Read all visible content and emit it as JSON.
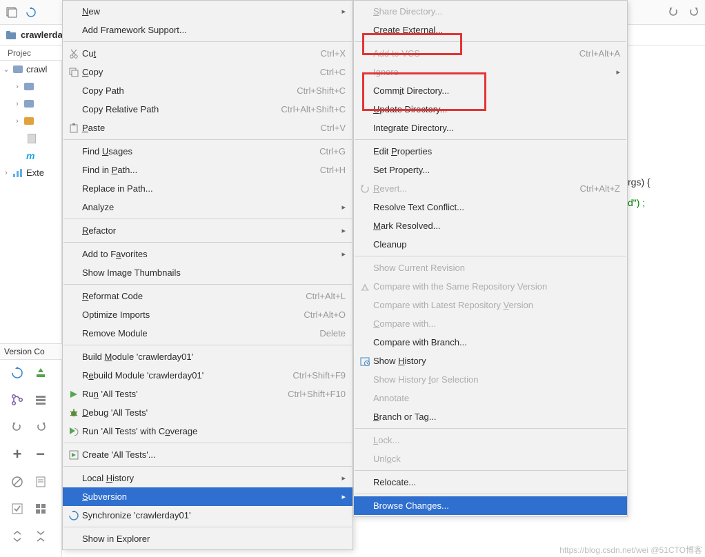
{
  "breadcrumb": {
    "project": "crawlerda"
  },
  "toolbar_tabs": {
    "project": "Projec"
  },
  "tree": {
    "root": "crawl",
    "meta": "m",
    "ext": "Exte"
  },
  "version_panel": {
    "title": "Version Co"
  },
  "editor": {
    "args_frag": "rgs) {",
    "d_frag": "d\") ;"
  },
  "watermark": "https://blog.csdn.net/wei @51CTO博客",
  "menu_main": {
    "new": "New",
    "add_framework": "Add Framework Support...",
    "cut": "Cut",
    "cut_sc": "Ctrl+X",
    "copy": "Copy",
    "copy_sc": "Ctrl+C",
    "copy_path": "Copy Path",
    "copy_path_sc": "Ctrl+Shift+C",
    "copy_rel": "Copy Relative Path",
    "copy_rel_sc": "Ctrl+Alt+Shift+C",
    "paste": "Paste",
    "paste_sc": "Ctrl+V",
    "find_usages": "Find Usages",
    "find_usages_sc": "Ctrl+G",
    "find_in_path": "Find in Path...",
    "find_in_path_sc": "Ctrl+H",
    "replace_in_path": "Replace in Path...",
    "analyze": "Analyze",
    "refactor": "Refactor",
    "add_fav": "Add to Favorites",
    "show_thumbs": "Show Image Thumbnails",
    "reformat": "Reformat Code",
    "reformat_sc": "Ctrl+Alt+L",
    "optimize": "Optimize Imports",
    "optimize_sc": "Ctrl+Alt+O",
    "remove_mod": "Remove Module",
    "remove_mod_sc": "Delete",
    "build_mod": "Build Module 'crawlerday01'",
    "rebuild_mod": "Rebuild Module 'crawlerday01'",
    "rebuild_mod_sc": "Ctrl+Shift+F9",
    "run": "Run 'All Tests'",
    "run_sc": "Ctrl+Shift+F10",
    "debug": "Debug 'All Tests'",
    "run_cov": "Run 'All Tests' with Coverage",
    "create_tests": "Create 'All Tests'...",
    "local_hist": "Local History",
    "subversion": "Subversion",
    "sync": "Synchronize 'crawlerday01'",
    "show_explorer": "Show in Explorer"
  },
  "menu_sub": {
    "share": "Share Directory...",
    "create_ext": "Create External...",
    "add_vcs": "Add to VCS",
    "add_vcs_sc": "Ctrl+Alt+A",
    "ignore": "Ignore",
    "commit": "Commit Directory...",
    "update": "Update Directory...",
    "integrate": "Integrate Directory...",
    "edit_props": "Edit Properties",
    "set_prop": "Set Property...",
    "revert": "Revert...",
    "revert_sc": "Ctrl+Alt+Z",
    "resolve_text": "Resolve Text Conflict...",
    "mark_res": "Mark Resolved...",
    "cleanup": "Cleanup",
    "show_rev": "Show Current Revision",
    "cmp_same": "Compare with the Same Repository Version",
    "cmp_latest": "Compare with Latest Repository Version",
    "cmp_with": "Compare with...",
    "cmp_branch": "Compare with Branch...",
    "show_hist": "Show History",
    "show_hist_sel": "Show History for Selection",
    "annotate": "Annotate",
    "branch_tag": "Branch or Tag...",
    "lock": "Lock...",
    "unlock": "Unlock",
    "relocate": "Relocate...",
    "browse_changes": "Browse Changes..."
  }
}
